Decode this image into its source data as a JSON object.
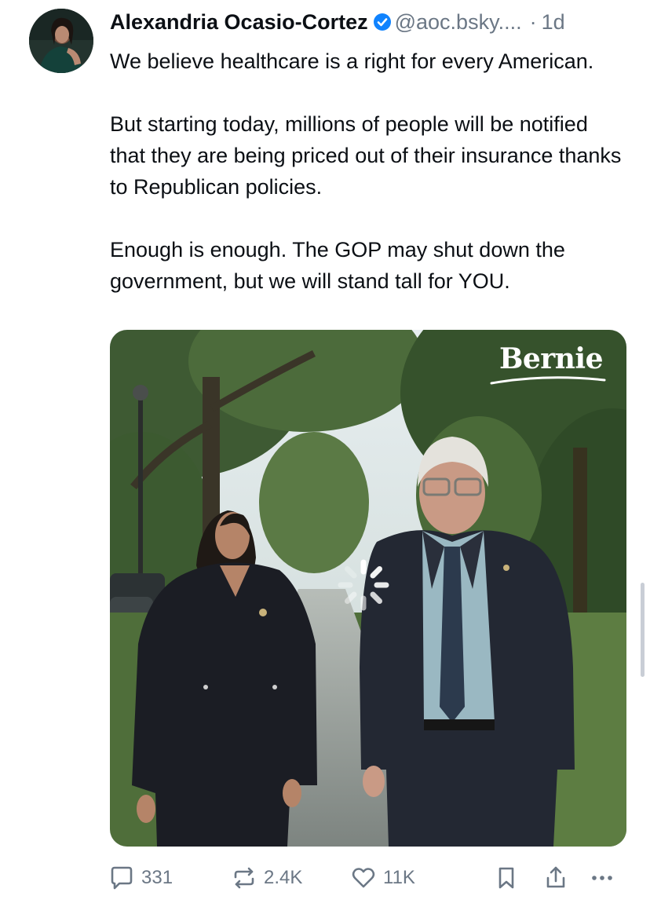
{
  "post": {
    "author": {
      "display_name": "Alexandria Ocasio-Cortez",
      "verified": true,
      "handle": "@aoc.bsky....",
      "avatar_icon": "profile-photo"
    },
    "separator": "·",
    "timestamp": "1d",
    "text": "We believe healthcare is a right for every American.\n\nBut starting today, millions of people will be notified that they are being priced out of their insurance thanks to Republican policies.\n\nEnough is enough. The GOP may shut down the government, but we will stand tall for YOU.",
    "media": {
      "type": "video",
      "logo_text": "Bernie",
      "state_icon": "loading-spinner"
    },
    "actions": {
      "reply_count": "331",
      "repost_count": "2.4K",
      "like_count": "11K"
    }
  },
  "colors": {
    "text": "#0b0f14",
    "secondary_text": "#6b7785",
    "verified_badge": "#1083fe",
    "background": "#ffffff"
  }
}
